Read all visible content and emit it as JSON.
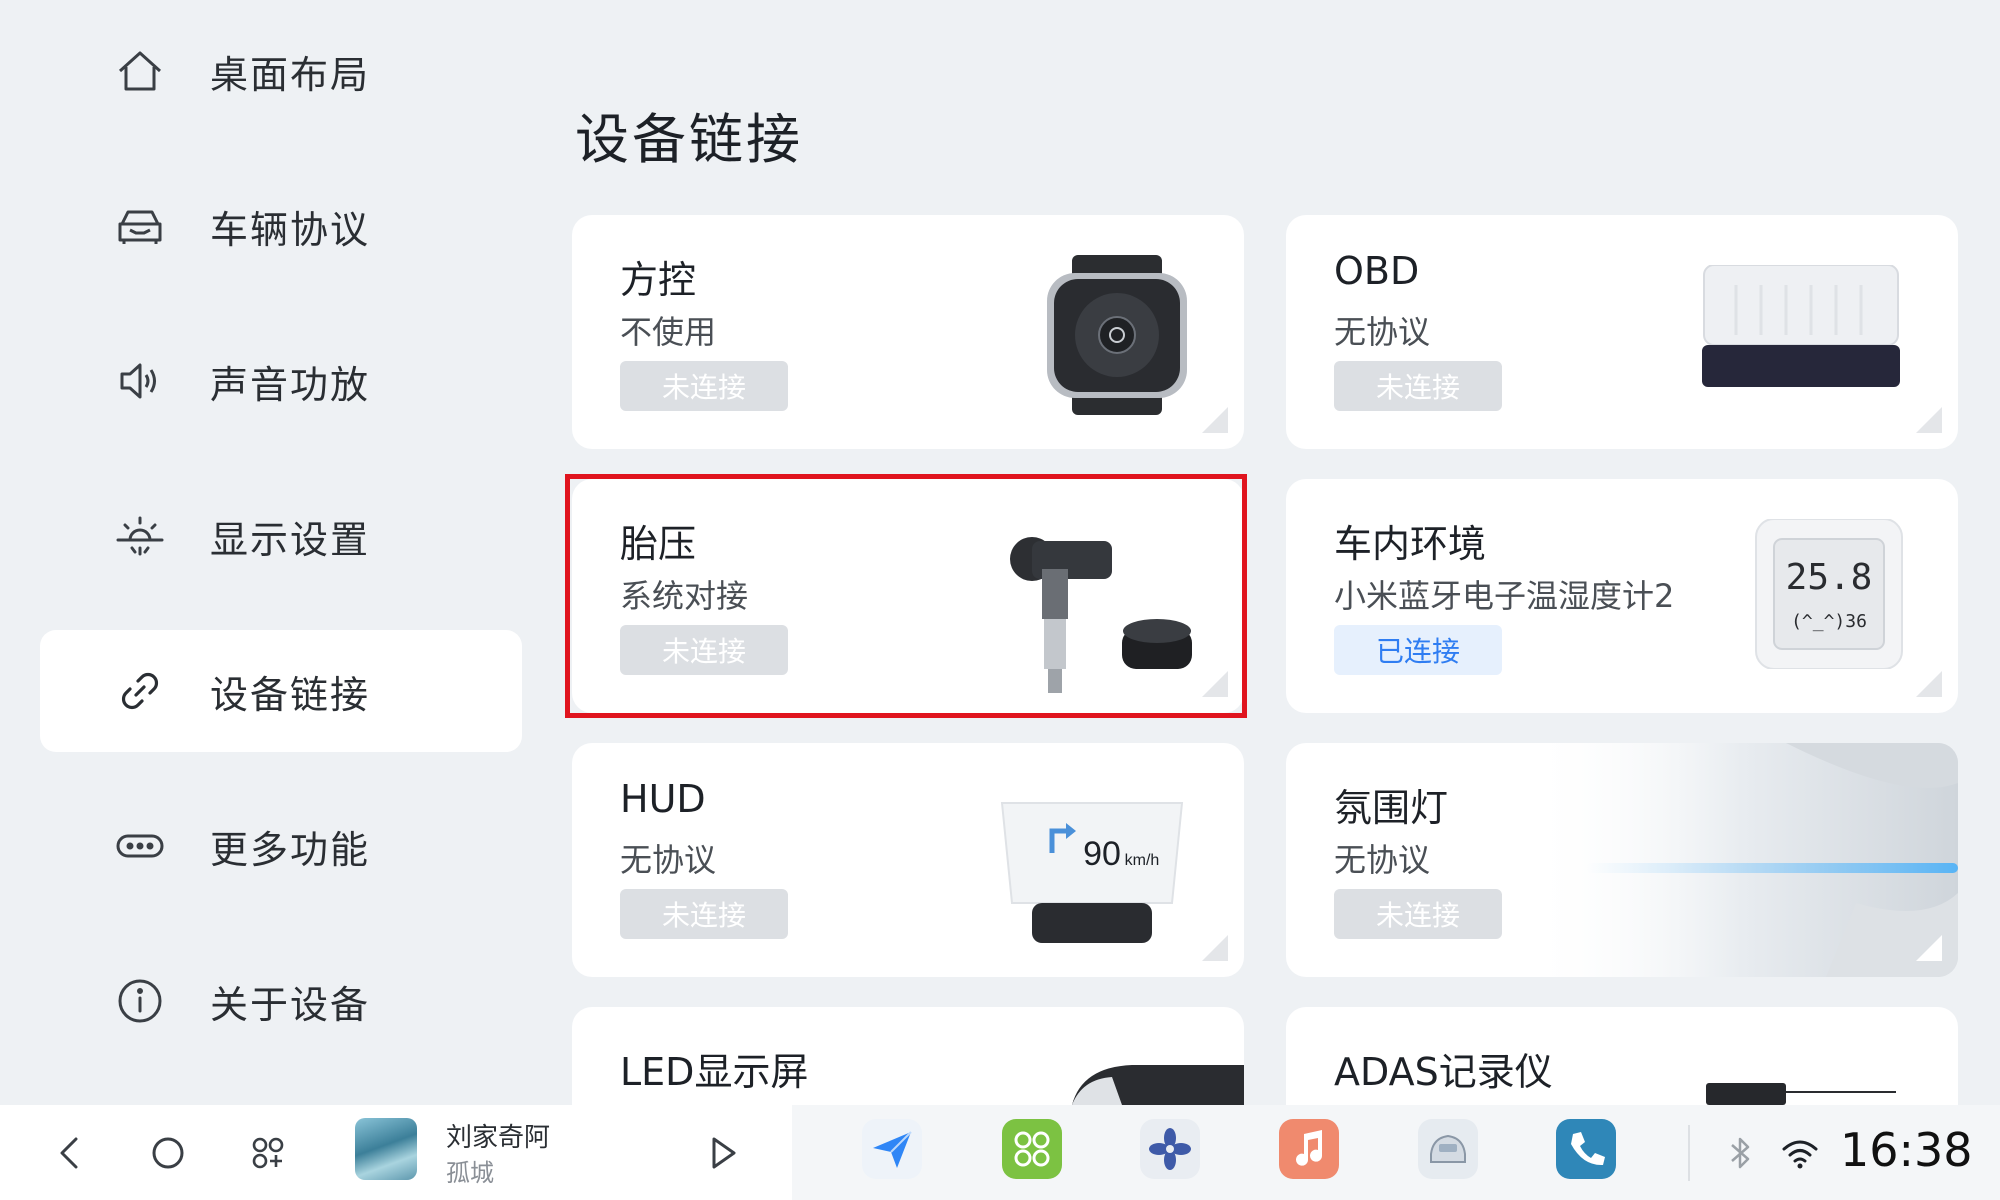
{
  "sidebar": {
    "items": [
      {
        "label": "桌面布局",
        "icon": "home-icon",
        "active": false
      },
      {
        "label": "车辆协议",
        "icon": "car-icon",
        "active": false
      },
      {
        "label": "声音功放",
        "icon": "speaker-icon",
        "active": false
      },
      {
        "label": "显示设置",
        "icon": "brightness-icon",
        "active": false
      },
      {
        "label": "设备链接",
        "icon": "link-icon",
        "active": true
      },
      {
        "label": "更多功能",
        "icon": "more-icon",
        "active": false
      },
      {
        "label": "关于设备",
        "icon": "info-icon",
        "active": false
      }
    ]
  },
  "main": {
    "title": "设备链接",
    "cards": [
      {
        "title": "方控",
        "subtitle": "不使用",
        "status": "未连接",
        "image": "steering-remote-image"
      },
      {
        "title": "OBD",
        "subtitle": "无协议",
        "status": "未连接",
        "image": "obd-adapter-image"
      },
      {
        "title": "胎压",
        "subtitle": "系统对接",
        "status": "未连接",
        "image": "tire-pressure-sensor-image"
      },
      {
        "title": "车内环境",
        "subtitle": "小米蓝牙电子温湿度计2",
        "status": "已连接",
        "image": "thermometer-image",
        "thermo_temp": "25.8",
        "thermo_hum": "(^_^)36"
      },
      {
        "title": "HUD",
        "subtitle": "无协议",
        "status": "未连接",
        "image": "hud-image",
        "hud_speed": "90",
        "hud_unit": "km/h"
      },
      {
        "title": "氛围灯",
        "subtitle": "无协议",
        "status": "未连接",
        "image": "ambient-light-image"
      },
      {
        "title": "LED显示屏",
        "subtitle": "",
        "status": "",
        "image": "led-display-image"
      },
      {
        "title": "ADAS记录仪",
        "subtitle": "",
        "status": "",
        "image": "adas-recorder-image"
      }
    ]
  },
  "taskbar": {
    "song": "刘家奇阿",
    "artist": "孤城",
    "apps": [
      "navigation-app-icon",
      "apps-app-icon",
      "fan-app-icon",
      "music-app-icon",
      "car-app-icon",
      "phone-app-icon"
    ],
    "time": "16:38"
  },
  "colors": {
    "background": "#eef1f4",
    "highlight": "#e0141e",
    "connected_text": "#2f7df2",
    "disconnected_badge": "#dcdfe3"
  }
}
